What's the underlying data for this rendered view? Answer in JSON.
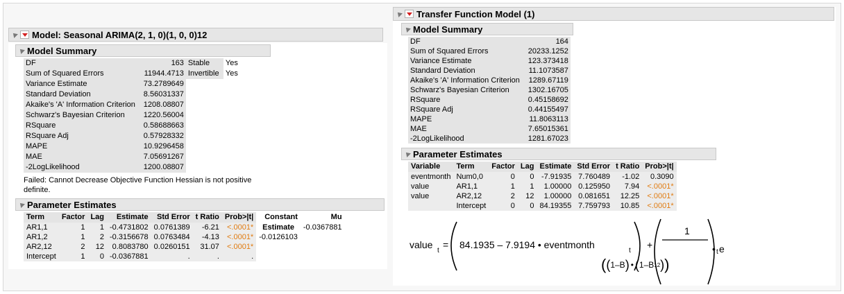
{
  "left": {
    "title": "Model: Seasonal ARIMA(2, 1, 0)(1, 0, 0)12",
    "summary": {
      "header": "Model Summary",
      "rows": [
        {
          "label": "DF",
          "value": "163"
        },
        {
          "label": "Sum of Squared Errors",
          "value": "11944.4713"
        },
        {
          "label": "Variance Estimate",
          "value": "73.2789649"
        },
        {
          "label": "Standard Deviation",
          "value": "8.56031337"
        },
        {
          "label": "Akaike's 'A' Information Criterion",
          "value": "1208.08807"
        },
        {
          "label": "Schwarz's Bayesian Criterion",
          "value": "1220.56004"
        },
        {
          "label": "RSquare",
          "value": "0.58688663"
        },
        {
          "label": "RSquare Adj",
          "value": "0.57928332"
        },
        {
          "label": "MAPE",
          "value": "10.9296458"
        },
        {
          "label": "MAE",
          "value": "7.05691267"
        },
        {
          "label": "-2LogLikelihood",
          "value": "1200.08807"
        }
      ],
      "flags": [
        {
          "label": "Stable",
          "value": "Yes"
        },
        {
          "label": "Invertible",
          "value": "Yes"
        }
      ],
      "failed_line1": "Failed: Cannot Decrease Objective Function Hessian is not positive",
      "failed_line2": "definite."
    },
    "params": {
      "header": "Parameter Estimates",
      "columns": [
        "Term",
        "Factor",
        "Lag",
        "Estimate",
        "Std Error",
        "t Ratio",
        "Prob>|t|",
        "Constant",
        "Mu"
      ],
      "constant_sub": "Estimate",
      "mu_value": "-0.0367881",
      "constant_value": "-0.0126103",
      "rows": [
        {
          "term": "AR1,1",
          "factor": "1",
          "lag": "1",
          "estimate": "-0.4731802",
          "stderr": "0.0761389",
          "tratio": "-6.21",
          "prob": "<.0001*"
        },
        {
          "term": "AR1,2",
          "factor": "1",
          "lag": "2",
          "estimate": "-0.3156678",
          "stderr": "0.0763484",
          "tratio": "-4.13",
          "prob": "<.0001*"
        },
        {
          "term": "AR2,12",
          "factor": "2",
          "lag": "12",
          "estimate": "0.8083780",
          "stderr": "0.0260151",
          "tratio": "31.07",
          "prob": "<.0001*"
        },
        {
          "term": "Intercept",
          "factor": "1",
          "lag": "0",
          "estimate": "-0.0367881",
          "stderr": ".",
          "tratio": ".",
          "prob": "."
        }
      ]
    }
  },
  "right": {
    "title": "Transfer Function Model (1)",
    "summary": {
      "header": "Model Summary",
      "rows": [
        {
          "label": "DF",
          "value": "164"
        },
        {
          "label": "Sum of Squared Errors",
          "value": "20233.1252"
        },
        {
          "label": "Variance Estimate",
          "value": "123.373418"
        },
        {
          "label": "Standard Deviation",
          "value": "11.1073587"
        },
        {
          "label": "Akaike's 'A' Information Criterion",
          "value": "1289.67119"
        },
        {
          "label": "Schwarz's Bayesian Criterion",
          "value": "1302.16705"
        },
        {
          "label": "RSquare",
          "value": "0.45158692"
        },
        {
          "label": "RSquare Adj",
          "value": "0.44155497"
        },
        {
          "label": "MAPE",
          "value": "11.8063113"
        },
        {
          "label": "MAE",
          "value": "7.65015361"
        },
        {
          "label": "-2LogLikelihood",
          "value": "1281.67023"
        }
      ]
    },
    "params": {
      "header": "Parameter Estimates",
      "columns": [
        "Variable",
        "Term",
        "Factor",
        "Lag",
        "Estimate",
        "Std Error",
        "t Ratio",
        "Prob>|t|"
      ],
      "rows": [
        {
          "variable": "eventmonth",
          "term": "Num0,0",
          "factor": "0",
          "lag": "0",
          "estimate": "-7.91935",
          "stderr": "7.760489",
          "tratio": "-1.02",
          "prob": "0.3090"
        },
        {
          "variable": "value",
          "term": "AR1,1",
          "factor": "1",
          "lag": "1",
          "estimate": "1.00000",
          "stderr": "0.125950",
          "tratio": "7.94",
          "prob": "<.0001*"
        },
        {
          "variable": "value",
          "term": "AR2,12",
          "factor": "2",
          "lag": "12",
          "estimate": "1.00000",
          "stderr": "0.081651",
          "tratio": "12.25",
          "prob": "<.0001*"
        },
        {
          "variable": "",
          "term": "Intercept",
          "factor": "0",
          "lag": "0",
          "estimate": "84.19355",
          "stderr": "7.759793",
          "tratio": "10.85",
          "prob": "<.0001*"
        }
      ]
    },
    "equation": {
      "lhs": "value",
      "sub_t": "t",
      "eq": "=",
      "inner": "84.1935 – 7.9194 • eventmonth",
      "plus": "+",
      "one": "1",
      "den1": "1–B",
      "den_dot": "•",
      "den2": "1–B",
      "sup12": "12",
      "dot": "•",
      "e": "e"
    }
  },
  "colors": {
    "significant": "#e07b10",
    "header_bg": "#e6e6e6",
    "red_triangle": "#d42020"
  }
}
